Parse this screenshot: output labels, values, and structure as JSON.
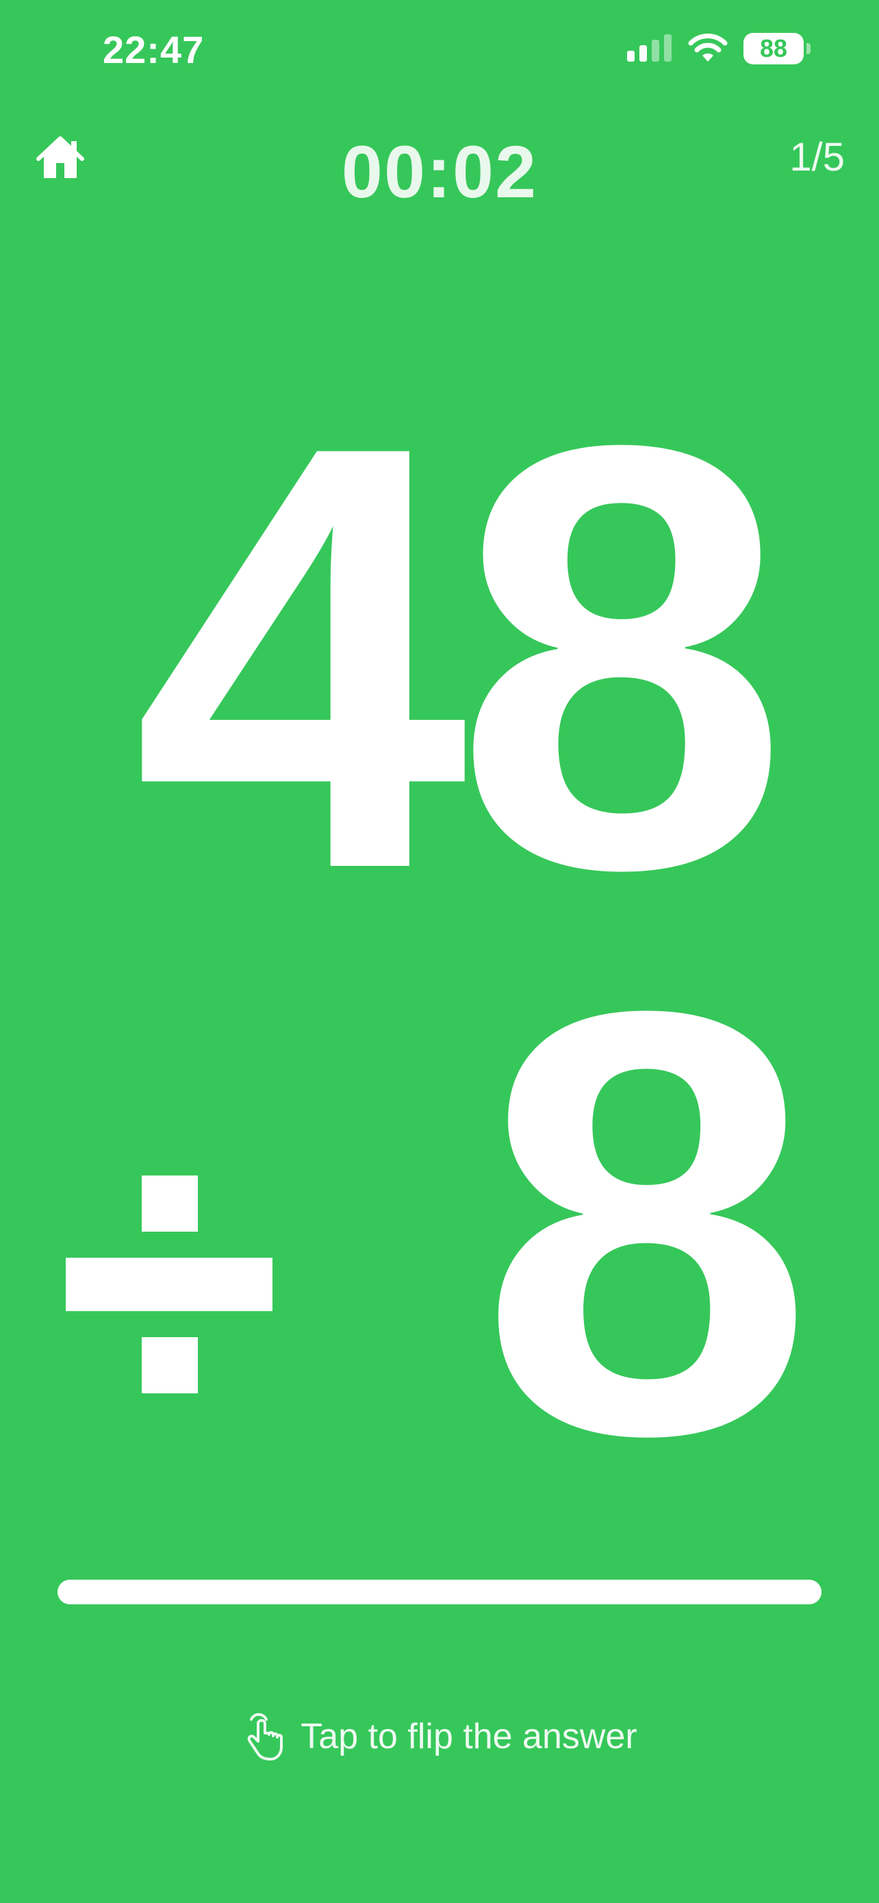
{
  "status_bar": {
    "time": "22:47",
    "battery": "88",
    "icons": [
      "signal-icon",
      "wifi-icon",
      "battery-icon"
    ]
  },
  "header": {
    "home_icon": "home-icon",
    "timer": "00:02",
    "progress": "1/5"
  },
  "problem": {
    "dividend": "48",
    "operator": "÷",
    "divisor": "8"
  },
  "footer": {
    "hint_icon": "tap-hand-icon",
    "hint_text": "Tap to flip the answer"
  },
  "colors": {
    "background": "#36c75a",
    "foreground": "#ffffff"
  }
}
